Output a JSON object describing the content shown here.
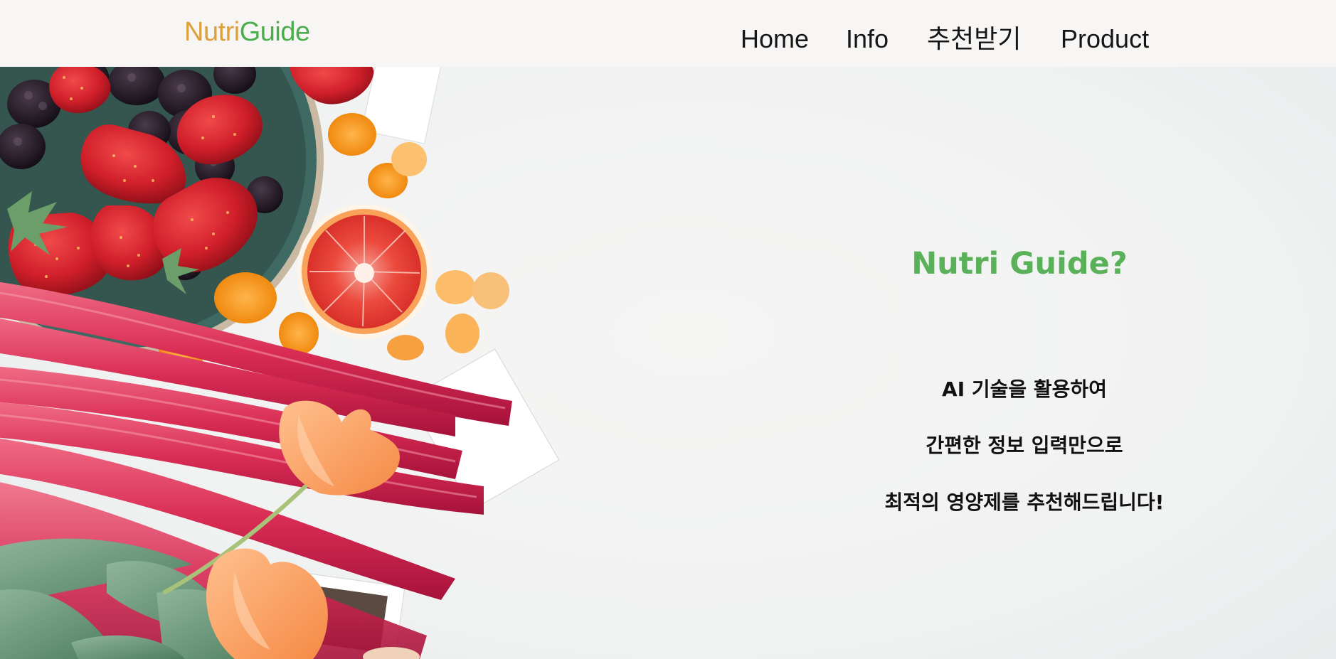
{
  "header": {
    "logo": {
      "part1": "Nutri",
      "part2": "Guide"
    },
    "nav": [
      {
        "label": "Home"
      },
      {
        "label": "Info"
      },
      {
        "label": "추천받기"
      },
      {
        "label": "Product"
      }
    ]
  },
  "hero": {
    "title": "Nutri Guide?",
    "lines": [
      "AI 기술을 활용하여",
      "간편한 정보 입력만으로",
      "최적의 영양제를 추천해드립니다!"
    ]
  },
  "colors": {
    "logo_orange": "#dca13a",
    "logo_green": "#4aae4d",
    "title_green": "#5ab15a",
    "header_bg": "#f8f6f4"
  }
}
